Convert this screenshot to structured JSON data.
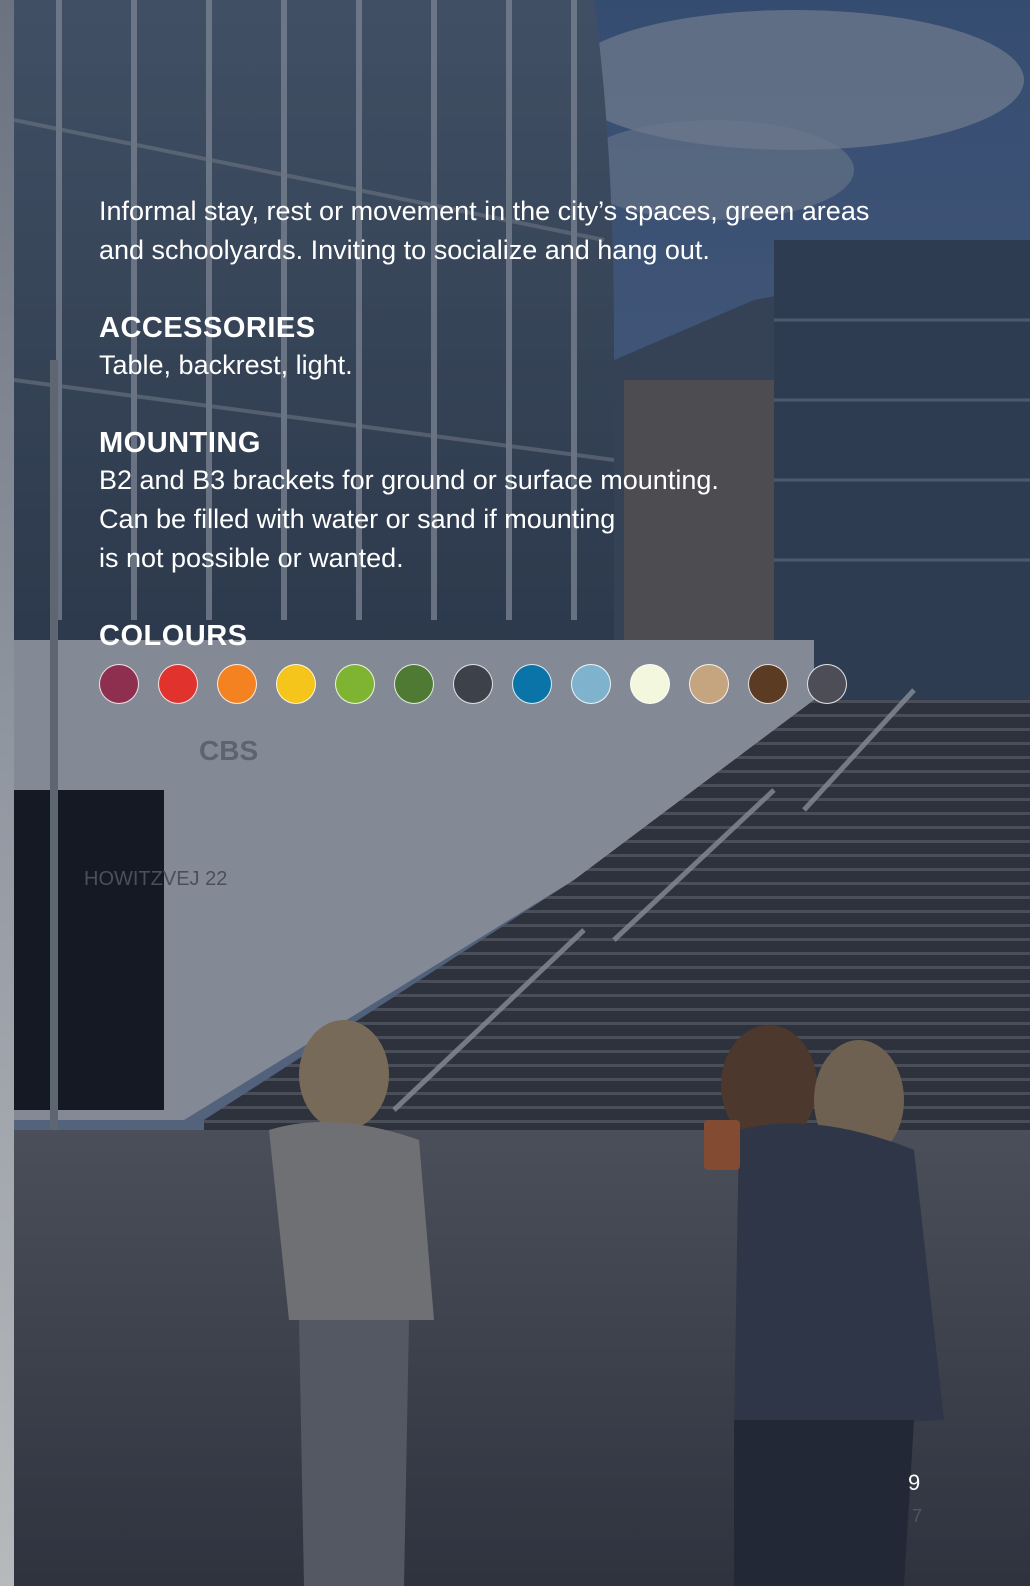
{
  "intro": "Informal stay, rest or movement in the city’s spaces, green areas and schoolyards. Inviting to socialize and hang out.",
  "accessories": {
    "heading": "ACCESSORIES",
    "text": "Table, backrest, light."
  },
  "mounting": {
    "heading": "MOUNTING",
    "lines": [
      "B2 and B3 brackets for ground or surface mounting.",
      "Can be filled with water or sand if mounting",
      "is not possible or wanted."
    ]
  },
  "colours": {
    "heading": "COLOURS",
    "swatches": [
      "#8e2f4f",
      "#e1322e",
      "#f58220",
      "#f6c51b",
      "#7fb432",
      "#4e7a34",
      "#3c414a",
      "#0a73a8",
      "#7fb2cc",
      "#f3f7dd",
      "#c5a480",
      "#5b3b22",
      "#4d4d57"
    ]
  },
  "photo_texts": {
    "building_sign": "CBS",
    "door_number": "HOWITZVEJ 22"
  },
  "page_number": "9",
  "page_number_secondary": "7"
}
